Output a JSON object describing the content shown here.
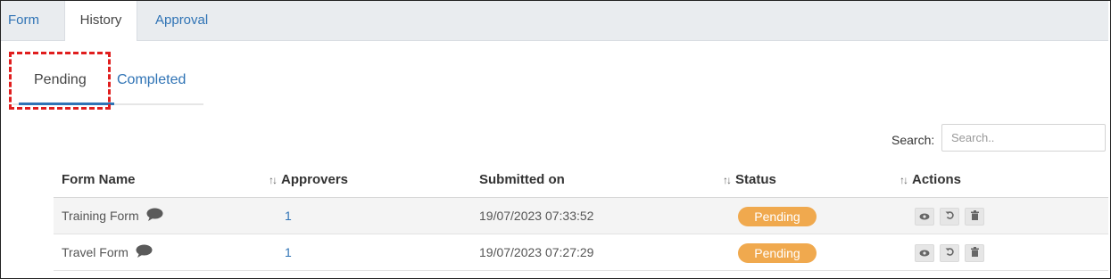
{
  "tabs": [
    {
      "label": "Form",
      "active": false
    },
    {
      "label": "History",
      "active": true
    },
    {
      "label": "Approval",
      "active": false
    }
  ],
  "subtabs": [
    {
      "label": "Pending",
      "active": true
    },
    {
      "label": "Completed",
      "active": false
    }
  ],
  "search": {
    "label": "Search:",
    "placeholder": "Search.."
  },
  "table": {
    "columns": [
      "Form Name",
      "Approvers",
      "Submitted on",
      "Status",
      "Actions"
    ],
    "rows": [
      {
        "form_name": "Training Form",
        "approvers": "1",
        "submitted_on": "19/07/2023 07:33:52",
        "status": "Pending"
      },
      {
        "form_name": "Travel Form",
        "approvers": "1",
        "submitted_on": "19/07/2023 07:27:29",
        "status": "Pending"
      }
    ]
  },
  "icons": {
    "comment": "comment-icon",
    "view": "eye-icon",
    "undo": "undo-icon",
    "delete": "trash-icon",
    "sort": "sort-icon"
  },
  "colors": {
    "accent": "#2f73b5",
    "status_pending": "#f0a94e",
    "highlight": "#e01e1e"
  }
}
